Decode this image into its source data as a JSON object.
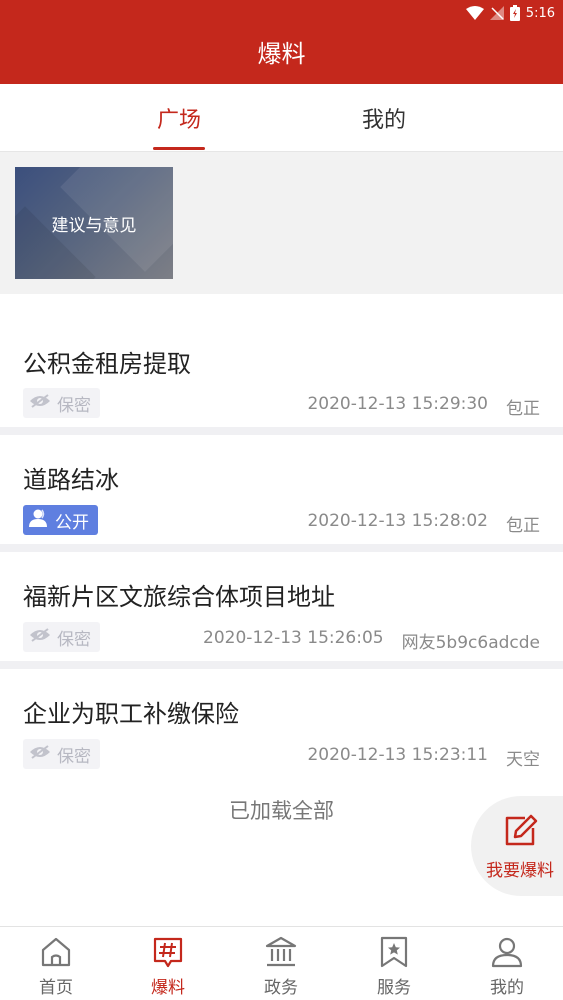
{
  "status_bar": {
    "time": "5:16"
  },
  "header": {
    "title": "爆料"
  },
  "tabs": [
    {
      "label": "广场",
      "active": true
    },
    {
      "label": "我的",
      "active": false
    }
  ],
  "banner": {
    "label": "建议与意见"
  },
  "posts": [
    {
      "title": "公积金租房提取",
      "privacy": "保密",
      "datetime": "2020-12-13 15:29:30",
      "author": "包正"
    },
    {
      "title": "道路结冰",
      "privacy": "公开",
      "datetime": "2020-12-13 15:28:02",
      "author": "包正"
    },
    {
      "title": "福新片区文旅综合体项目地址",
      "privacy": "保密",
      "datetime": "2020-12-13 15:26:05",
      "author": "网友5b9c6adcde"
    },
    {
      "title": "企业为职工补缴保险",
      "privacy": "保密",
      "datetime": "2020-12-13 15:23:11",
      "author": "天空"
    }
  ],
  "list_footer": "已加载全部",
  "fab": {
    "label": "我要爆料",
    "icon": "edit-icon"
  },
  "bottom_nav": [
    {
      "label": "首页",
      "icon": "home-icon",
      "active": false
    },
    {
      "label": "爆料",
      "icon": "hashtag-icon",
      "active": true
    },
    {
      "label": "政务",
      "icon": "government-building-icon",
      "active": false
    },
    {
      "label": "服务",
      "icon": "bookmark-star-icon",
      "active": false
    },
    {
      "label": "我的",
      "icon": "user-icon",
      "active": false
    }
  ],
  "colors": {
    "brand": "#c4281c",
    "public_badge": "#5f7fe0",
    "secret_badge_bg": "#f3f3f6"
  }
}
